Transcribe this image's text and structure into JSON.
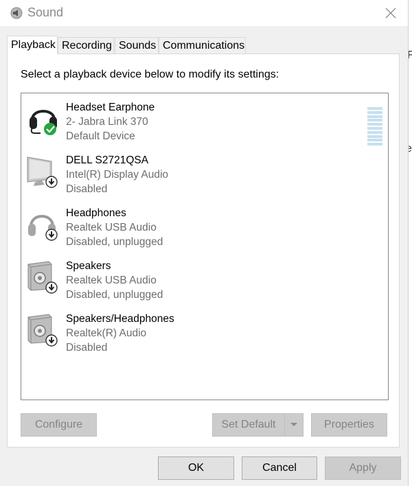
{
  "window": {
    "title": "Sound"
  },
  "tabs": [
    {
      "label": "Playback",
      "active": true
    },
    {
      "label": "Recording",
      "active": false
    },
    {
      "label": "Sounds",
      "active": false
    },
    {
      "label": "Communications",
      "active": false
    }
  ],
  "instruction": "Select a playback device below to modify its settings:",
  "devices": [
    {
      "name": "Headset Earphone",
      "line2": "2- Jabra Link 370",
      "line3": "Default Device",
      "icon": "headset-icon",
      "status": "default"
    },
    {
      "name": "DELL S2721QSA",
      "line2": "Intel(R) Display Audio",
      "line3": "Disabled",
      "icon": "monitor-icon",
      "status": "disabled"
    },
    {
      "name": "Headphones",
      "line2": "Realtek USB Audio",
      "line3": "Disabled, unplugged",
      "icon": "headphones-icon",
      "status": "disabled"
    },
    {
      "name": "Speakers",
      "line2": "Realtek USB Audio",
      "line3": "Disabled, unplugged",
      "icon": "speaker-icon",
      "status": "disabled"
    },
    {
      "name": "Speakers/Headphones",
      "line2": "Realtek(R) Audio",
      "line3": "Disabled",
      "icon": "speaker-icon",
      "status": "disabled"
    }
  ],
  "buttons": {
    "configure": "Configure",
    "set_default": "Set Default",
    "properties": "Properties",
    "ok": "OK",
    "cancel": "Cancel",
    "apply": "Apply"
  },
  "colors": {
    "default_check": "#27a644",
    "level_meter": "#c7e0ef",
    "disabled_text": "#838383"
  }
}
